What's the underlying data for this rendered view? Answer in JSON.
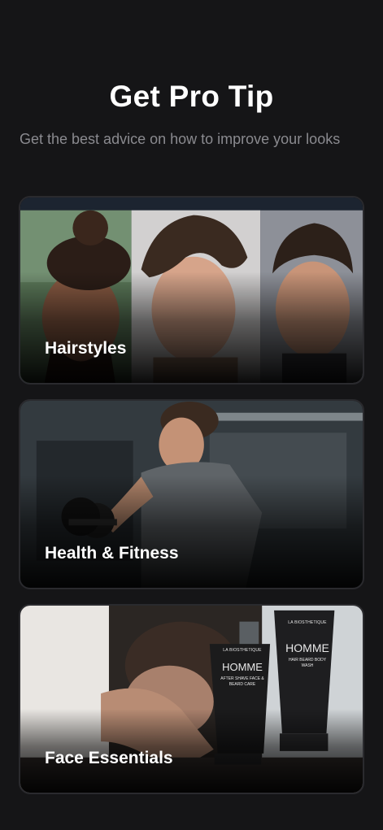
{
  "header": {
    "title": "Get Pro Tip",
    "subtitle": "Get the best advice on how to improve your looks"
  },
  "cards": [
    {
      "label": "Hairstyles"
    },
    {
      "label": "Health & Fitness"
    },
    {
      "label": "Face Essentials"
    }
  ],
  "colors": {
    "background": "#151517",
    "card_border": "#2a2a2e",
    "subtitle": "#8a8a8f"
  },
  "products": {
    "bottle_small": {
      "brand": "LA BIOSTHETIQUE",
      "name": "HOMME",
      "desc": "AFTER SHAVE FACE & BEARD CARE"
    },
    "bottle_large": {
      "brand": "LA BIOSTHETIQUE",
      "name": "HOMME",
      "desc": "HAIR BEARD BODY WASH"
    }
  }
}
